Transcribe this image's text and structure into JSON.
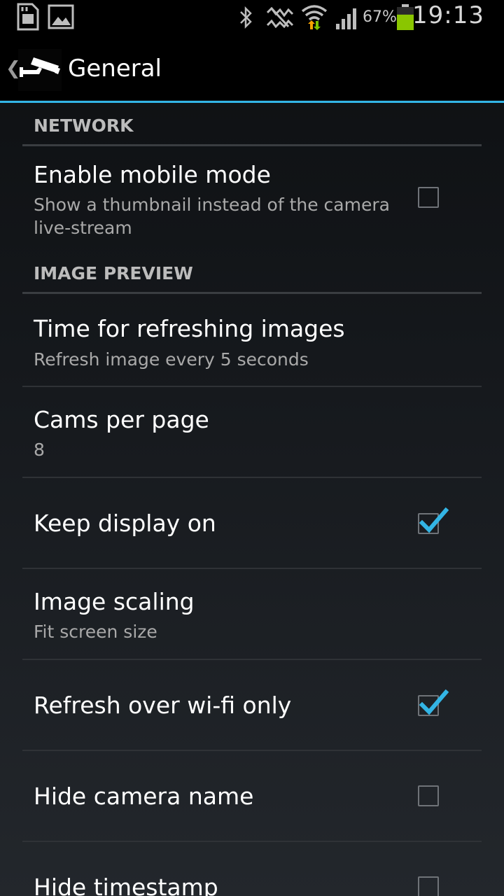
{
  "status_bar": {
    "battery_percent": "67%",
    "battery_level": 0.67,
    "time": "19:13",
    "icons": [
      "sd-card-icon",
      "gallery-icon",
      "bluetooth-icon",
      "mute-icon",
      "wifi-icon",
      "signal-icon",
      "battery-icon"
    ]
  },
  "action_bar": {
    "title": "General",
    "app_icon": "security-camera-icon",
    "accent_color": "#33b5e5"
  },
  "sections": [
    {
      "header": "NETWORK"
    },
    {
      "header": "IMAGE PREVIEW"
    }
  ],
  "preferences": [
    {
      "title": "Enable mobile mode",
      "summary": "Show a thumbnail instead of the camera live-stream",
      "checked": false
    },
    {
      "title": "Time for refreshing images",
      "summary": "Refresh image every 5 seconds"
    },
    {
      "title": "Cams per page",
      "summary": "8"
    },
    {
      "title": "Keep display on",
      "checked": true
    },
    {
      "title": "Image scaling",
      "summary": "Fit screen size"
    },
    {
      "title": "Refresh over wi-fi only",
      "checked": true
    },
    {
      "title": "Hide camera name",
      "checked": false
    },
    {
      "title": "Hide timestamp",
      "checked": false
    }
  ]
}
